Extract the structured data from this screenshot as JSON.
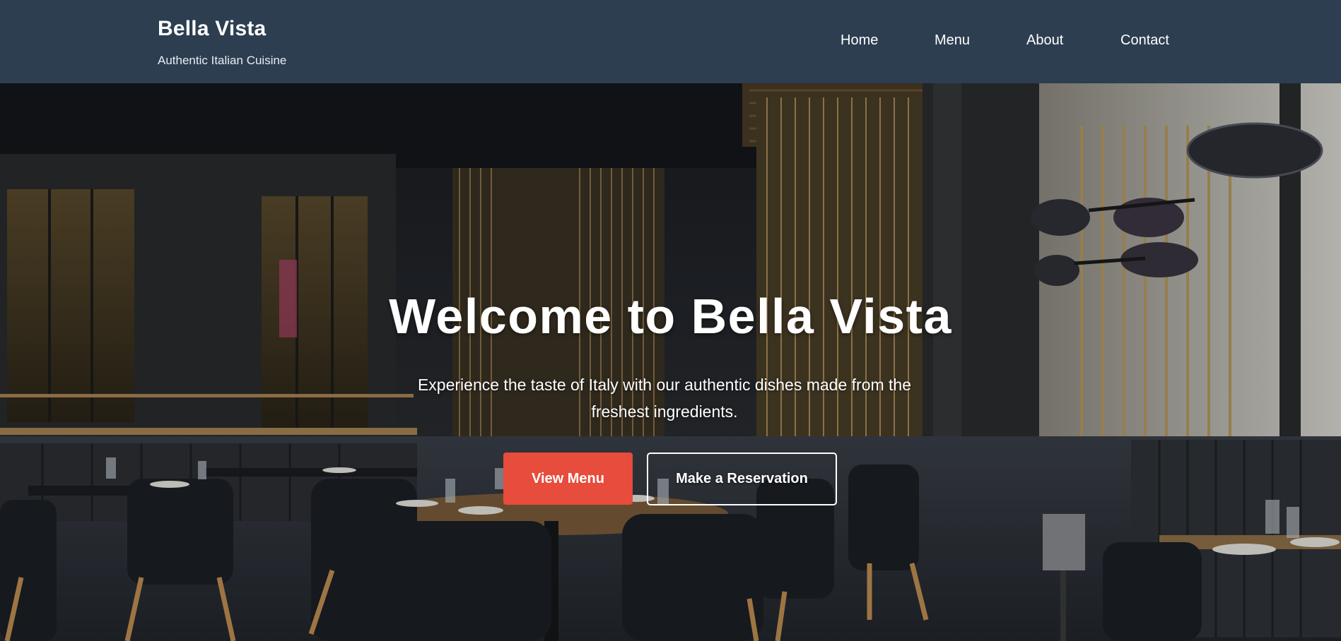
{
  "header": {
    "brand_name": "Bella Vista",
    "tagline": "Authentic Italian Cuisine",
    "background_color": "#2c3e50"
  },
  "nav": {
    "items": [
      {
        "label": "Home"
      },
      {
        "label": "Menu"
      },
      {
        "label": "About"
      },
      {
        "label": "Contact"
      }
    ]
  },
  "hero": {
    "background_image": "restaurant-interior-photo",
    "title": "Welcome to Bella Vista",
    "subtitle": "Experience the taste of Italy with our authentic dishes made from the freshest ingredients.",
    "primary_button": "View Menu",
    "secondary_button": "Make a Reservation",
    "accent_color": "#e74c3c"
  }
}
